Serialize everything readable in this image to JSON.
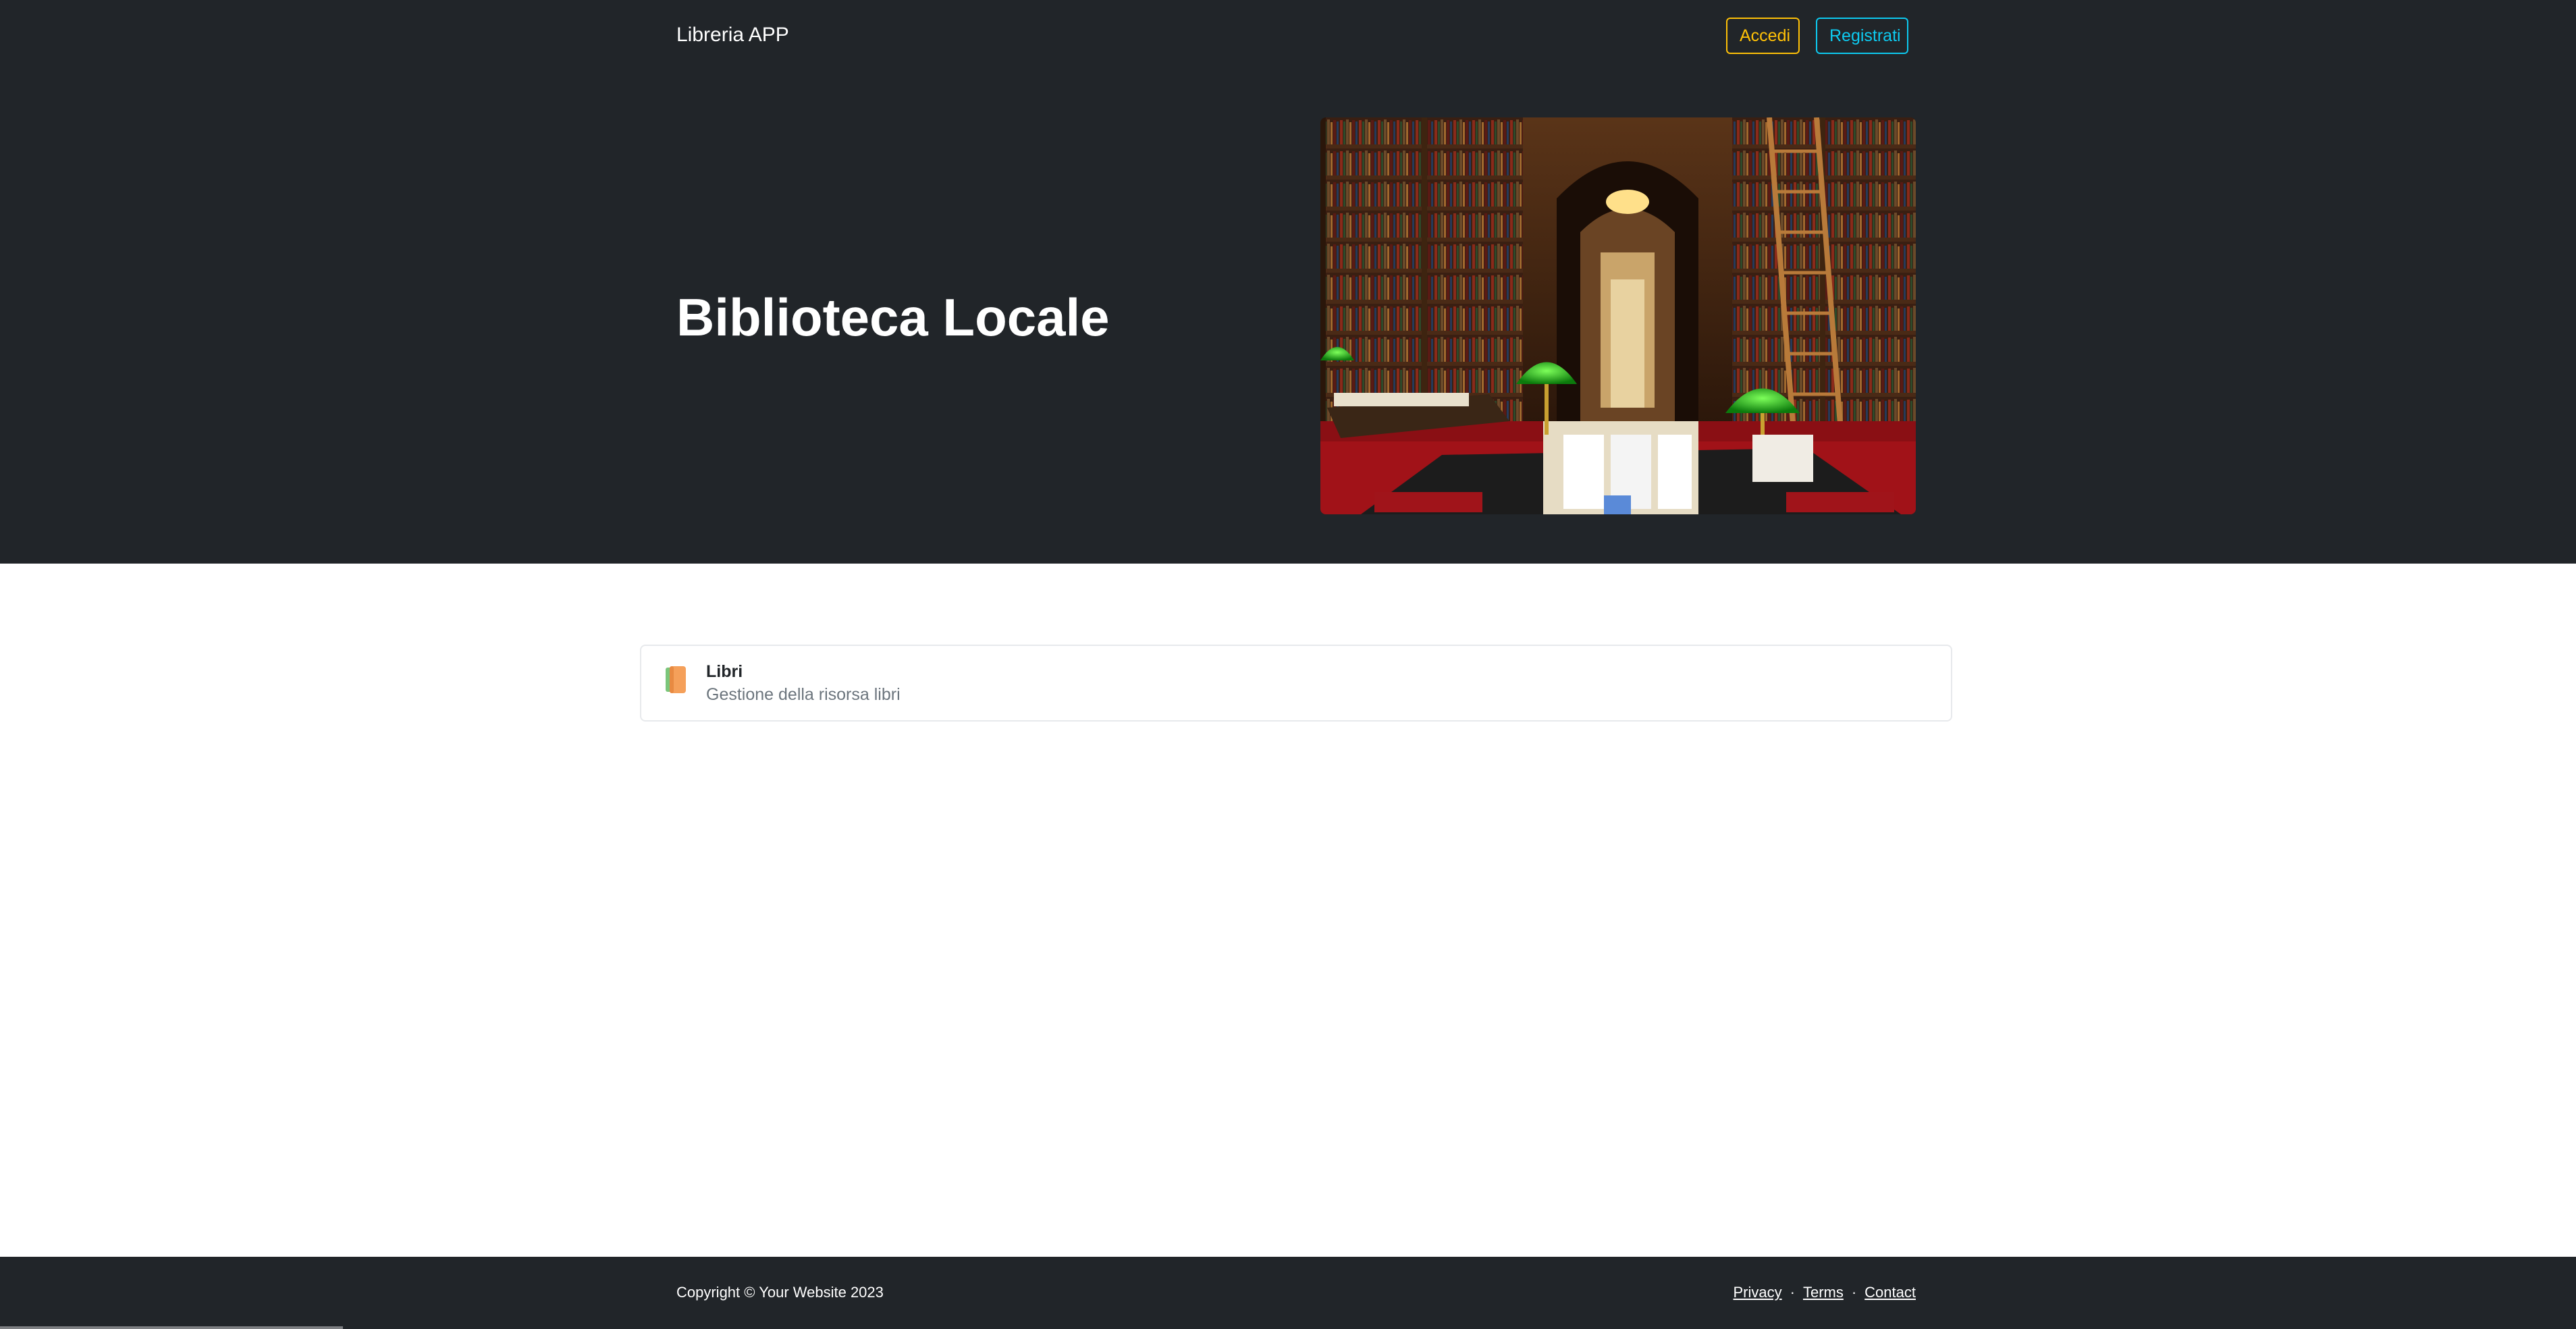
{
  "navbar": {
    "brand": "Libreria APP",
    "login_label": "Accedi",
    "register_label": "Registrati"
  },
  "hero": {
    "title": "Biblioteca Locale",
    "image_alt": "library-interior-photo"
  },
  "cards": [
    {
      "title": "Libri",
      "subtitle": "Gestione della risorsa libri",
      "icon": "books-icon"
    }
  ],
  "footer": {
    "copyright": "Copyright © Your Website 2023",
    "links": [
      "Privacy",
      "Terms",
      "Contact"
    ],
    "separator": "·"
  },
  "colors": {
    "dark_bg": "#212529",
    "login_accent": "#ffc107",
    "register_accent": "#0dcaf0",
    "muted_text": "#6c757d"
  }
}
